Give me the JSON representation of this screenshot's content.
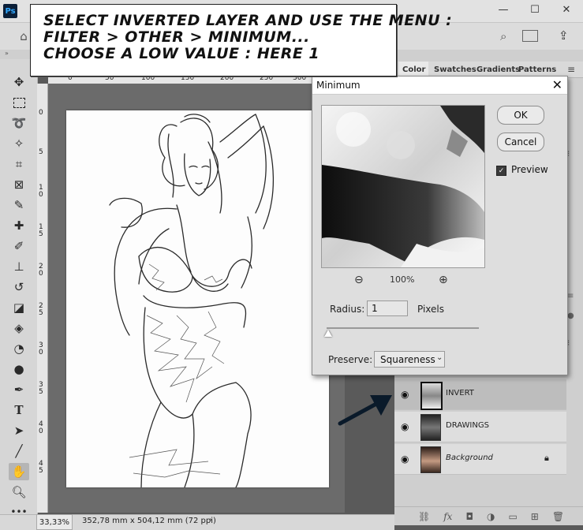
{
  "app": {
    "logo": "Ps"
  },
  "window_controls": {
    "minimize": "—",
    "maximize": "☐",
    "close": "✕"
  },
  "annotation": {
    "lines": [
      "SELECT INVERTED LAYER AND USE THE MENU :",
      "FILTER > OTHER > MINIMUM...",
      "CHOOSE A LOW VALUE : HERE 1"
    ]
  },
  "rulers": {
    "horizontal": [
      "0",
      "50",
      "100",
      "150",
      "200",
      "250",
      "300"
    ],
    "vertical": [
      "0",
      "5",
      "1 0",
      "1 5",
      "2 0",
      "2 5",
      "3 0",
      "3 5",
      "4 0",
      "4 5"
    ]
  },
  "panel_tabs": [
    "Color",
    "Swatches",
    "Gradients",
    "Patterns"
  ],
  "dialog": {
    "title": "Minimum",
    "ok_label": "OK",
    "cancel_label": "Cancel",
    "preview_label": "Preview",
    "preview_checked": true,
    "zoom": "100%",
    "radius_label": "Radius:",
    "radius_value": "1",
    "radius_unit": "Pixels",
    "radius_slider_fraction": 0.01,
    "preserve_label": "Preserve:",
    "preserve_value": "Squareness"
  },
  "layers": [
    {
      "name": "INVERT",
      "selected": true,
      "italic": false,
      "locked": false
    },
    {
      "name": "DRAWINGS",
      "selected": false,
      "italic": false,
      "locked": false
    },
    {
      "name": "Background",
      "selected": false,
      "italic": true,
      "locked": true
    }
  ],
  "status": {
    "zoom": "33,33%",
    "doc_info": "352,78 mm x 504,12 mm (72 ppi)",
    "arrow": "›"
  },
  "colors": {
    "arrow": "#0a1a2a",
    "selected_layer": "#bdbdbd"
  }
}
